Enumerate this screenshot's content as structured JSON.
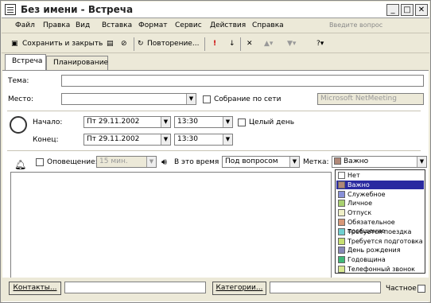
{
  "window": {
    "title": "Без имени - Встреча"
  },
  "menu": [
    "Файл",
    "Правка",
    "Вид",
    "Вставка",
    "Формат",
    "Сервис",
    "Действия",
    "Справка"
  ],
  "help_placeholder": "Введите вопрос",
  "toolbar": {
    "save_close": "Сохранить и закрыть",
    "recurrence": "Повторение..."
  },
  "tabs": [
    "Встреча",
    "Планирование"
  ],
  "form": {
    "subject_label": "Тема:",
    "location_label": "Место:",
    "online_label": "Собрание по сети",
    "netmeeting": "Microsoft NetMeeting",
    "start_label": "Начало:",
    "end_label": "Конец:",
    "start_date": "Пт 29.11.2002",
    "end_date": "Пт 29.11.2002",
    "start_time": "13:30",
    "end_time": "13:30",
    "allday_label": "Целый день",
    "reminder_label": "Оповещение:",
    "reminder_value": "15 мин.",
    "show_as_label": "В это время",
    "show_as_value": "Под вопросом",
    "label_label": "Метка:",
    "label_value": "Важно"
  },
  "label_options": [
    {
      "text": "Нет",
      "color": "#ffffff"
    },
    {
      "text": "Важно",
      "color": "#b08878",
      "selected": true
    },
    {
      "text": "Служебное",
      "color": "#8890d8"
    },
    {
      "text": "Личное",
      "color": "#a8d070"
    },
    {
      "text": "Отпуск",
      "color": "#f0f0c8"
    },
    {
      "text": "Обязательное посещение",
      "color": "#d89878"
    },
    {
      "text": "Требуется поездка",
      "color": "#70d0d0"
    },
    {
      "text": "Требуется подготовка",
      "color": "#c8e070"
    },
    {
      "text": "День рождения",
      "color": "#8888b8"
    },
    {
      "text": "Годовщина",
      "color": "#40b878"
    },
    {
      "text": "Телефонный звонок",
      "color": "#d8e890"
    }
  ],
  "footer": {
    "contacts": "Контакты...",
    "categories": "Категории...",
    "private": "Частное"
  }
}
